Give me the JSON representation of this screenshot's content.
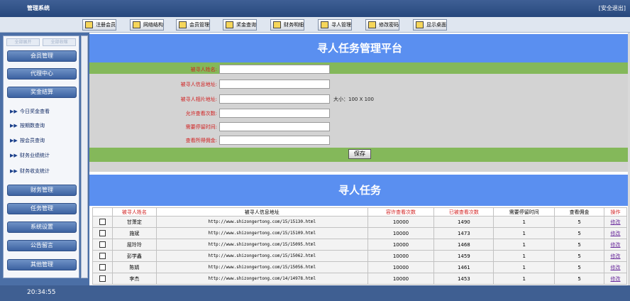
{
  "app": {
    "title": "管理系统",
    "logout": "[安全退出]"
  },
  "toolbar": {
    "buttons": [
      {
        "label": "注册会员",
        "icon": "register-icon"
      },
      {
        "label": "网络结构",
        "icon": "network-icon"
      },
      {
        "label": "会员管理",
        "icon": "member-icon"
      },
      {
        "label": "奖金查询",
        "icon": "bonus-icon"
      },
      {
        "label": "财务明细",
        "icon": "finance-icon"
      },
      {
        "label": "寻人管理",
        "icon": "search-person-icon"
      },
      {
        "label": "修改密码",
        "icon": "key-icon"
      },
      {
        "label": "显示桌面",
        "icon": "desktop-icon"
      }
    ]
  },
  "sidebar": {
    "tabs": [
      "全部展开",
      "全部收缩"
    ],
    "menus": {
      "m1": "会员管理",
      "m2": "代理中心",
      "m3": "奖金结算",
      "m4": "财务管理",
      "m5": "任务管理",
      "m6": "系统设置",
      "m7": "公告留言",
      "m8": "其他管理"
    },
    "sub": {
      "s1": "今日奖金查看",
      "s2": "按期数查询",
      "s3": "按会员查询",
      "s4": "财务业绩统计",
      "s5": "财务收支统计"
    },
    "bullet": "▶▶"
  },
  "status": {
    "time": "20:34:55"
  },
  "main": {
    "platform_title": "寻人任务管理平台",
    "form": {
      "name_label": "被寻人姓名:",
      "info_label": "被寻人信息地址:",
      "photo_label": "被寻人相片地址:",
      "allow_label": "允许查看次数:",
      "stay_label": "需要停留时间:",
      "commission_label": "查看所得佣金:",
      "size_note": "大小：100 X 100",
      "save": "保存"
    },
    "task_title": "寻人任务",
    "table": {
      "headers": {
        "name": "被寻人姓名",
        "url": "被寻人信息地址",
        "allow": "容许查看次数",
        "viewed": "已被查看次数",
        "stay": "需要停留时间",
        "commission": "查看佣金",
        "action": "操作"
      },
      "rows": [
        {
          "name": "甘萧定",
          "url": "http://www.shizongertong.com/15/15130.html",
          "allow": "10000",
          "viewed": "1490",
          "stay": "1",
          "commission": "5",
          "action": "修改"
        },
        {
          "name": "施斌",
          "url": "http://www.shizongertong.com/15/15109.html",
          "allow": "10000",
          "viewed": "1473",
          "stay": "1",
          "commission": "5",
          "action": "修改"
        },
        {
          "name": "屈玲玲",
          "url": "http://www.shizongertong.com/15/15095.html",
          "allow": "10000",
          "viewed": "1468",
          "stay": "1",
          "commission": "5",
          "action": "修改"
        },
        {
          "name": "彭学鑫",
          "url": "http://www.shizongertong.com/15/15062.html",
          "allow": "10000",
          "viewed": "1459",
          "stay": "1",
          "commission": "5",
          "action": "修改"
        },
        {
          "name": "陈婧",
          "url": "http://www.shizongertong.com/15/15056.html",
          "allow": "10000",
          "viewed": "1461",
          "stay": "1",
          "commission": "5",
          "action": "修改"
        },
        {
          "name": "李杰",
          "url": "http://www.shizongertong.com/14/14978.html",
          "allow": "10000",
          "viewed": "1453",
          "stay": "1",
          "commission": "5",
          "action": "修改"
        }
      ]
    }
  }
}
